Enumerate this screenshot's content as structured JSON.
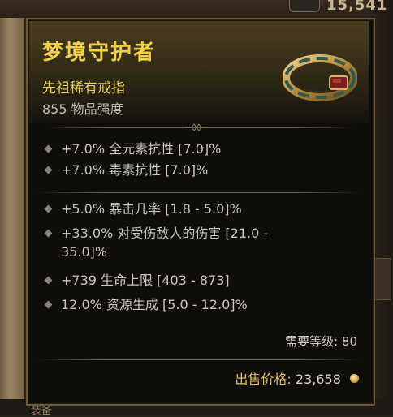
{
  "top_bar": {
    "gold_display": "15,541"
  },
  "bottom_bar": {
    "label": "装备"
  },
  "item": {
    "name": "梦境守护者",
    "type": "先祖稀有戒指",
    "item_power": "855 物品强度",
    "implicit_affixes": [
      {
        "text": "+7.0% 全元素抗性 [7.0]%"
      },
      {
        "text": "+7.0% 毒素抗性 [7.0]%"
      }
    ],
    "affixes": [
      {
        "text": "+5.0% 暴击几率 [1.8 - 5.0]%"
      },
      {
        "line1": "+33.0% 对受伤敌人的伤害 [21.0 -",
        "line2": "35.0]%"
      },
      {
        "text": "+739 生命上限 [403 - 873]"
      },
      {
        "text": "12.0% 资源生成 [5.0 - 12.0]%"
      }
    ],
    "required_level": "需要等级: 80",
    "sell_label": "出售价格:",
    "sell_value": "23,658"
  },
  "colors": {
    "title": "#f3d24a",
    "rarity": "#e9cf4e",
    "affix_text": "#c9c5bd",
    "panel_border": "#6b5a34"
  },
  "icons": {
    "ring": "ring-icon",
    "coin": "gold-coin-icon",
    "bullet": "diamond-bullet-icon"
  }
}
